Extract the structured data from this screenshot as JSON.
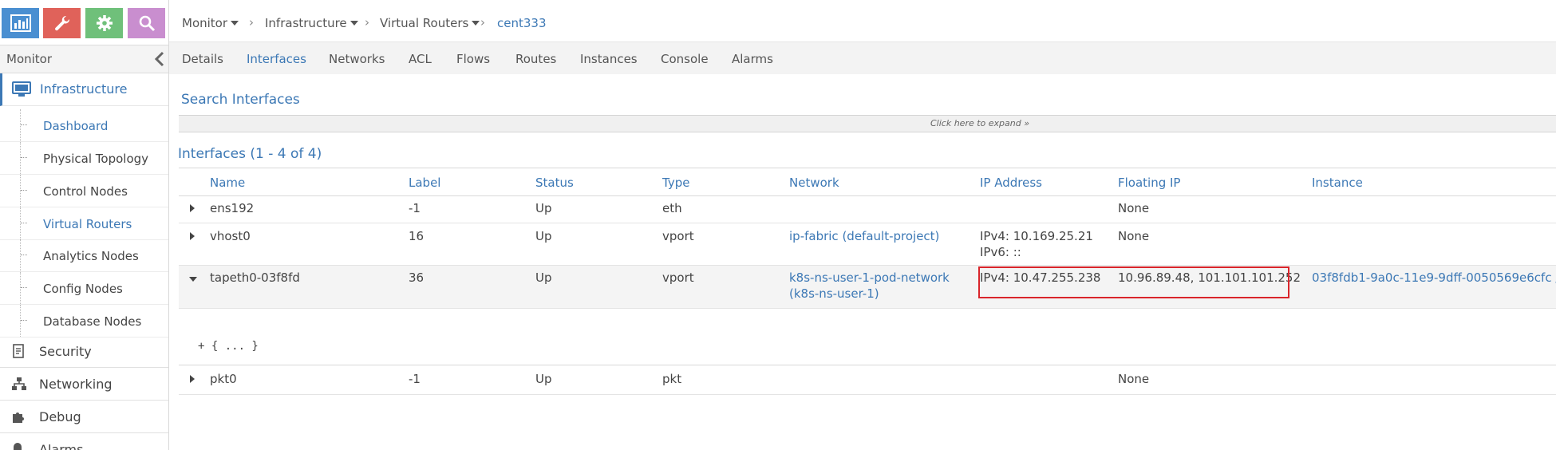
{
  "colors": {
    "accent": "#3c78b5",
    "highlight": "#d9252b",
    "icon_monitor": "#4a8fd1",
    "icon_configure": "#e0625a",
    "icon_settings": "#6fc07a",
    "icon_query": "#c98ecf"
  },
  "sidebar": {
    "top_icons": [
      "monitor-chart-icon",
      "wrench-icon",
      "gear-icon",
      "search-icon"
    ],
    "header": "Monitor",
    "section": {
      "label": "Infrastructure",
      "icon": "monitor-display-icon"
    },
    "sub_items": [
      {
        "label": "Dashboard",
        "active": true
      },
      {
        "label": "Physical Topology",
        "active": false
      },
      {
        "label": "Control Nodes",
        "active": false
      },
      {
        "label": "Virtual Routers",
        "active": true
      },
      {
        "label": "Analytics Nodes",
        "active": false
      },
      {
        "label": "Config Nodes",
        "active": false
      },
      {
        "label": "Database Nodes",
        "active": false
      }
    ],
    "main_items": [
      {
        "label": "Security",
        "icon": "document-icon"
      },
      {
        "label": "Networking",
        "icon": "network-tree-icon"
      },
      {
        "label": "Debug",
        "icon": "puzzle-icon"
      },
      {
        "label": "Alarms",
        "icon": "bell-icon"
      }
    ]
  },
  "breadcrumb": {
    "items": [
      "Monitor",
      "Infrastructure",
      "Virtual Routers"
    ],
    "current": "cent333"
  },
  "tabs": [
    "Details",
    "Interfaces",
    "Networks",
    "ACL",
    "Flows",
    "Routes",
    "Instances",
    "Console",
    "Alarms"
  ],
  "active_tab": "Interfaces",
  "search": {
    "title": "Search Interfaces",
    "expand_label": "Click here to expand »"
  },
  "grid": {
    "title": "Interfaces (1 - 4 of 4)",
    "columns": [
      "Name",
      "Label",
      "Status",
      "Type",
      "Network",
      "IP Address",
      "Floating IP",
      "Instance"
    ],
    "rows": [
      {
        "name": "ens192",
        "label": "-1",
        "status": "Up",
        "type": "eth",
        "network": "",
        "ip_line1": "",
        "ip_line2": "",
        "floating_ip": "None",
        "instance": ""
      },
      {
        "name": "vhost0",
        "label": "16",
        "status": "Up",
        "type": "vport",
        "network": "ip-fabric (default-project)",
        "ip_line1": "IPv4: 10.169.25.21",
        "ip_line2": "IPv6: ::",
        "floating_ip": "None",
        "instance": ""
      },
      {
        "name": "tapeth0-03f8fd",
        "label": "36",
        "status": "Up",
        "type": "vport",
        "network": "k8s-ns-user-1-pod-network (k8s-ns-user-1)",
        "ip_line1": "IPv4: 10.47.255.238",
        "ip_line2": "",
        "floating_ip": "10.96.89.48, 101.101.101.252",
        "instance": "03f8fdb1-9a0c-11e9-9dff-0050569e6cfc /"
      },
      {
        "name": "pkt0",
        "label": "-1",
        "status": "Up",
        "type": "pkt",
        "network": "",
        "ip_line1": "",
        "ip_line2": "",
        "floating_ip": "None",
        "instance": ""
      }
    ],
    "json_toggle": "+ { ... }"
  }
}
